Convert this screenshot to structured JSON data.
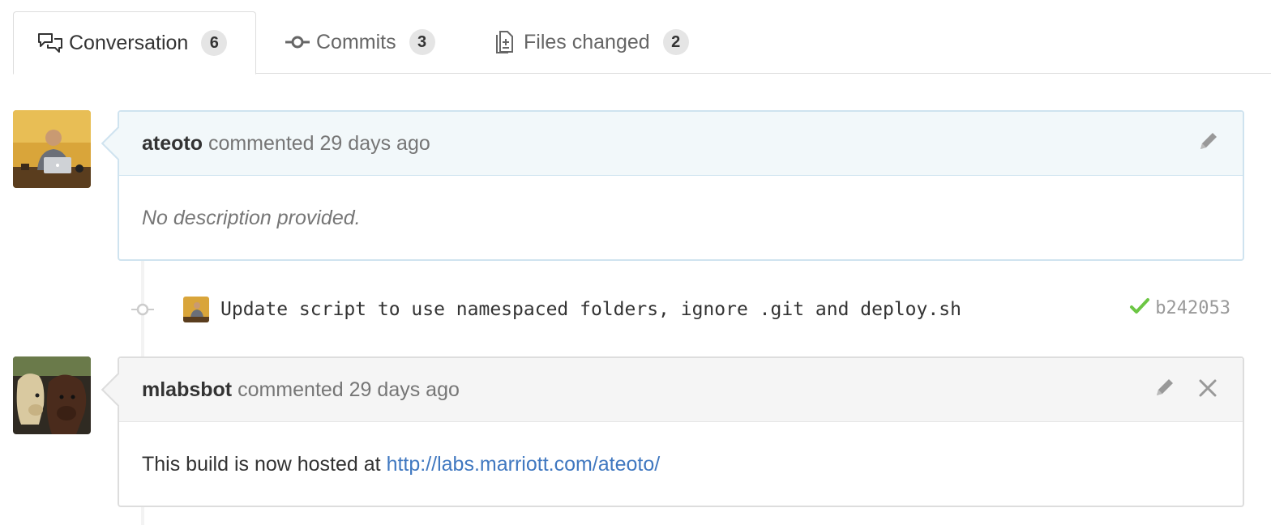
{
  "tabs": [
    {
      "label": "Conversation",
      "count": "6",
      "icon": "comment-discussion-icon"
    },
    {
      "label": "Commits",
      "count": "3",
      "icon": "git-commit-icon"
    },
    {
      "label": "Files changed",
      "count": "2",
      "icon": "file-diff-icon"
    }
  ],
  "comments": [
    {
      "author": "ateoto",
      "action": "commented",
      "time": "29 days ago",
      "body": "No description provided."
    },
    {
      "author": "mlabsbot",
      "action": "commented",
      "time": "29 days ago",
      "body_prefix": "This build is now hosted at",
      "body_link": "http://labs.marriott.com/ateoto/"
    }
  ],
  "commit": {
    "message": "Update script to use namespaced folders, ignore .git and deploy.sh",
    "sha": "b242053",
    "status": "success"
  },
  "colors": {
    "link": "#4078c0",
    "success": "#6cc644",
    "comment_header_bg": "#f2f8fa",
    "comment_border": "#cfe3ef"
  }
}
